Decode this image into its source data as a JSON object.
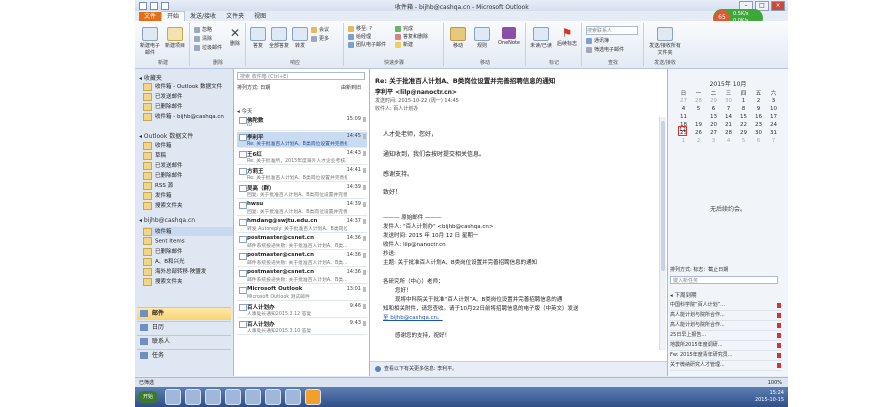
{
  "window_title": "收件箱 - bijhb@cashqa.cn - Microsoft Outlook",
  "ribbon_tabs": [
    "文件",
    "开始",
    "发送/接收",
    "文件夹",
    "视图"
  ],
  "user_badge": {
    "initial": "65",
    "line1": "0.5K/s",
    "line2": "0.0K/s"
  },
  "ribbon_groups": [
    {
      "label": "新建",
      "buttons": [
        "新建电子邮件",
        "新建项目"
      ]
    },
    {
      "label": "删除",
      "buttons": [
        "忽略",
        "清除",
        "垃圾邮件",
        "删除"
      ]
    },
    {
      "label": "响应",
      "buttons": [
        "答复",
        "全部答复",
        "转发",
        "会议",
        "更多"
      ]
    },
    {
      "label": "快速步骤",
      "buttons": [
        "移至: ?",
        "给经理",
        "团队电子邮件",
        "完成",
        "答复和删除",
        "新建"
      ]
    },
    {
      "label": "移动",
      "buttons": [
        "移动",
        "规则",
        "OneNote"
      ]
    },
    {
      "label": "标记",
      "buttons": [
        "未读/已读",
        "后续标志"
      ]
    },
    {
      "label": "查找",
      "buttons": [
        "搜索联系人",
        "通讯簿",
        "筛选电子邮件"
      ]
    },
    {
      "label": "发送/接收",
      "buttons": [
        "发送/接收所有文件夹"
      ]
    }
  ],
  "folders": {
    "favorites_header": "◂ 收藏夹",
    "favorites": [
      "收件箱 - Outlook 数据文件",
      "已发送邮件",
      "已删除邮件",
      "收件箱 - bijhb@cashqa.cn"
    ],
    "pst_header": "◂ Outlook 数据文件",
    "pst": [
      "收件箱",
      "草稿",
      "已发送邮件",
      "已删除邮件",
      "RSS 源",
      "发件箱",
      "搜索文件夹"
    ],
    "account_header": "◂ bijhb@cashqa.cn",
    "account": [
      "收件箱",
      "Sent Items",
      "已删除邮件",
      "A、B和兴光",
      "海外总部转移·陕盟发",
      "搜索文件夹"
    ],
    "nav": [
      "邮件",
      "日历",
      "联系人",
      "任务"
    ]
  },
  "message_list": {
    "search_placeholder": "搜索 收件箱 (Ctrl+E)",
    "sort_label": "排列方式: 日期",
    "sort_order": "由新到旧",
    "group_today": "◂ 今天",
    "messages": [
      {
        "sender": "佛陀数",
        "preview": "ID",
        "time": "15:09"
      },
      {
        "sender": "李利平",
        "preview": "Re: 关于批准百人计划A、B类岗位设置并完善招聘...",
        "time": "14:45"
      },
      {
        "sender": "王6红",
        "preview": "Re: 关于批准所，2015年度海外人才企业考核...",
        "time": "14:43"
      },
      {
        "sender": "方莉王",
        "preview": "Re: 关于批准百人计划A、B类岗位设置并完善招聘...",
        "time": "14:41"
      },
      {
        "sender": "吴高（群）",
        "preview": "回复: 关于批准百人计划A、B类岗位设置并完善...",
        "time": "14:39"
      },
      {
        "sender": "hwsu",
        "preview": "回复: 关于批准百人计划A、B类岗位设置并完善...",
        "time": "14:39"
      },
      {
        "sender": "hmdang@swjtu.edu.cn",
        "preview": "转发 Autoreply: 关于批准百人计划A、B类岗位...",
        "time": "14:37"
      },
      {
        "sender": "postmaster@csnet.cn",
        "preview": "邮件系统投递失败: 关于批准百人计划A、B类...",
        "time": "14:36"
      },
      {
        "sender": "postmaster@csnet.cn",
        "preview": "邮件系统投递失败: 关于批准百人计划A、B类...",
        "time": "14:36"
      },
      {
        "sender": "postmaster@csnet.cn",
        "preview": "邮件系统投递失败: 关于批准百人计划A、B类...",
        "time": "14:36"
      },
      {
        "sender": "Microsoft Outlook",
        "preview": "Microsoft Outlook 测试邮件",
        "time": "13:01"
      },
      {
        "sender": "百人计划办",
        "preview": "人事处长通知2015.3.12 答复",
        "time": "9:46"
      },
      {
        "sender": "百人计划办",
        "preview": "人事处长通知2015.3.10 答复",
        "time": "9:43"
      }
    ]
  },
  "reading": {
    "subject": "Re: 关于批准百人计划A、B类岗位设置并完善招聘信息的通知",
    "from": "李利平 <lilp@nanoctr.cn>",
    "sent_label": "发送时间:",
    "sent": "2015-10-22 (周一) 14:45",
    "to_label": "收件人:",
    "to": "百人计划办",
    "body": [
      "人才处老师，您好，",
      "通知收到，我们会按时提交相关信息。",
      "感谢支持。",
      "致好！"
    ],
    "quote_header": "——— 原始邮件 ———",
    "quote_from": "发件人: \"百人计划办\" <bijhb@cashqa.cn>",
    "quote_time": "发送时间: 2015 年 10月 12 日  星期一",
    "quote_to": "收件人: lilp@nanoctr.cn",
    "quote_cc": "抄送:",
    "quote_subject": "主题: 关于批准百人计划A、B类岗位设置并完善招聘信息的通知",
    "quote_body1": "各研究所（中心）老师：",
    "quote_body2": "您好！",
    "quote_body3": "现将中科院关于批准“百人计划”A、B类岗位设置并完善招聘信息的通",
    "quote_body4": "知和相关附件，请您查收。请于10月22日前将招聘信息的电子版（中英文）发送",
    "quote_body5": "至 bijhb@cashqa.cn。",
    "quote_thanks": "感谢您的支持，祝好！",
    "footer": "查看以下有关更多信息: 李利平。"
  },
  "todo": {
    "calendar_title": "2015年 10月",
    "weekdays": [
      "日",
      "一",
      "二",
      "三",
      "四",
      "五",
      "六"
    ],
    "weeks": [
      [
        "27",
        "28",
        "29",
        "30",
        "1",
        "2",
        "3"
      ],
      [
        "4",
        "5",
        "6",
        "7",
        "8",
        "9",
        "10"
      ],
      [
        "11",
        "12",
        "13",
        "14",
        "15",
        "16",
        "17"
      ],
      [
        "18",
        "19",
        "20",
        "21",
        "22",
        "23",
        "24"
      ],
      [
        "25",
        "26",
        "27",
        "28",
        "29",
        "30",
        "31"
      ],
      [
        "1",
        "2",
        "3",
        "4",
        "5",
        "6",
        "7"
      ]
    ],
    "no_appointments": "无后续约会。",
    "tasks_header": "排列方式: 标志：截止日期",
    "tasks_input": "键入新任务",
    "tasks_sub": "◂ 下周到期",
    "tasks": [
      "中国科学院“百人计划”...",
      "高人能计划与院所合作...",
      "高人能计划与院所合作...",
      "25日早上报告...",
      "地震所2015年度调研...",
      "Fw: 2015年度青年研究员...",
      "关于微纳研究人才管理..."
    ]
  },
  "status": {
    "left": "已筛选",
    "right": "100%"
  },
  "taskbar": {
    "start": "开始",
    "clock_time": "15:24",
    "clock_date": "2015-10-15"
  }
}
